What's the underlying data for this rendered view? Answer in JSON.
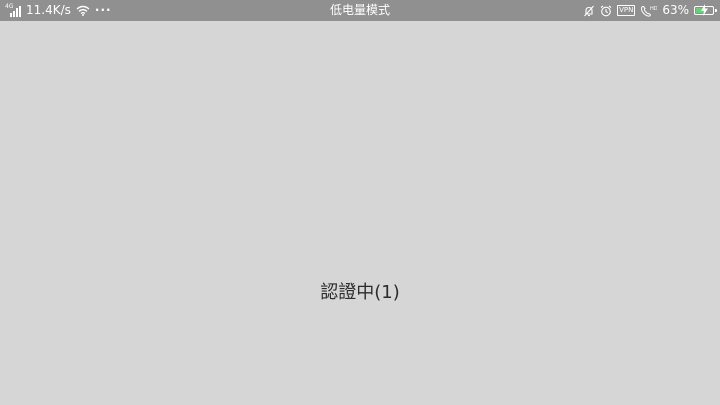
{
  "status_bar": {
    "network_type": "4G",
    "speed": "11.4K/s",
    "more": "···",
    "mode": "低电量模式",
    "vpn_label": "VPN",
    "hd_label": "HD",
    "battery_percent": "63%",
    "battery_level": 0.63,
    "battery_color": "#59d96a",
    "icons": [
      "signal-icon",
      "wifi-icon",
      "more-icon",
      "mute-bell-icon",
      "alarm-icon",
      "vpn-icon",
      "hd-call-icon",
      "battery-icon"
    ]
  },
  "main": {
    "message": "認證中(1)"
  }
}
